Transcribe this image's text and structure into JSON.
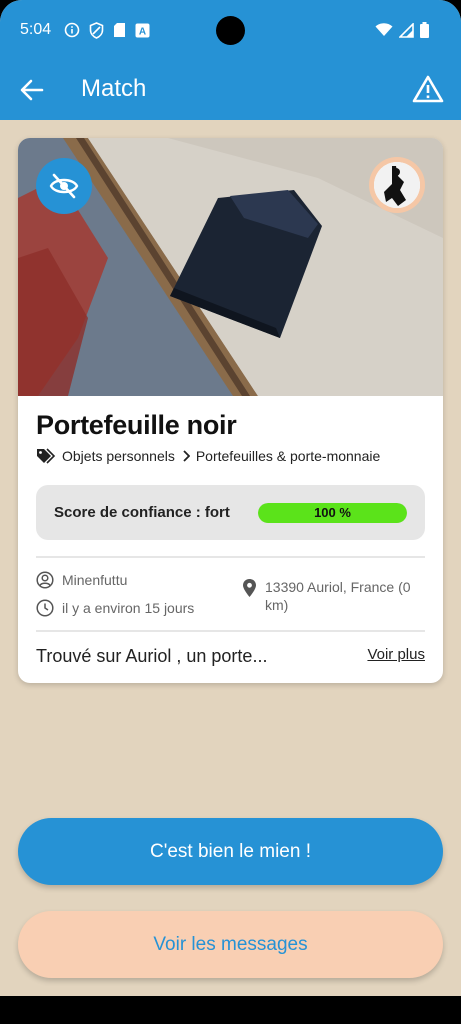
{
  "status_bar": {
    "time": "5:04"
  },
  "header": {
    "title": "Match"
  },
  "item": {
    "title": "Portefeuille noir",
    "category": "Objets personnels",
    "subcategory": "Portefeuilles & porte-monnaie",
    "confidence_label": "Score de confiance : fort",
    "confidence_value": "100 %",
    "confidence_fraction": 1.0,
    "user": "Minenfuttu",
    "time_ago": "il y a environ 15 jours",
    "location": "13390 Auriol, France (0 km)",
    "description": "Trouvé sur Auriol , un porte...",
    "see_more": "Voir plus"
  },
  "actions": {
    "confirm": "C'est bien le mien !",
    "messages": "Voir les messages"
  },
  "colors": {
    "primary": "#2692d5",
    "background": "#e2d4be",
    "confidence_fill": "#5be31a",
    "secondary_button": "#f9cfb3"
  }
}
